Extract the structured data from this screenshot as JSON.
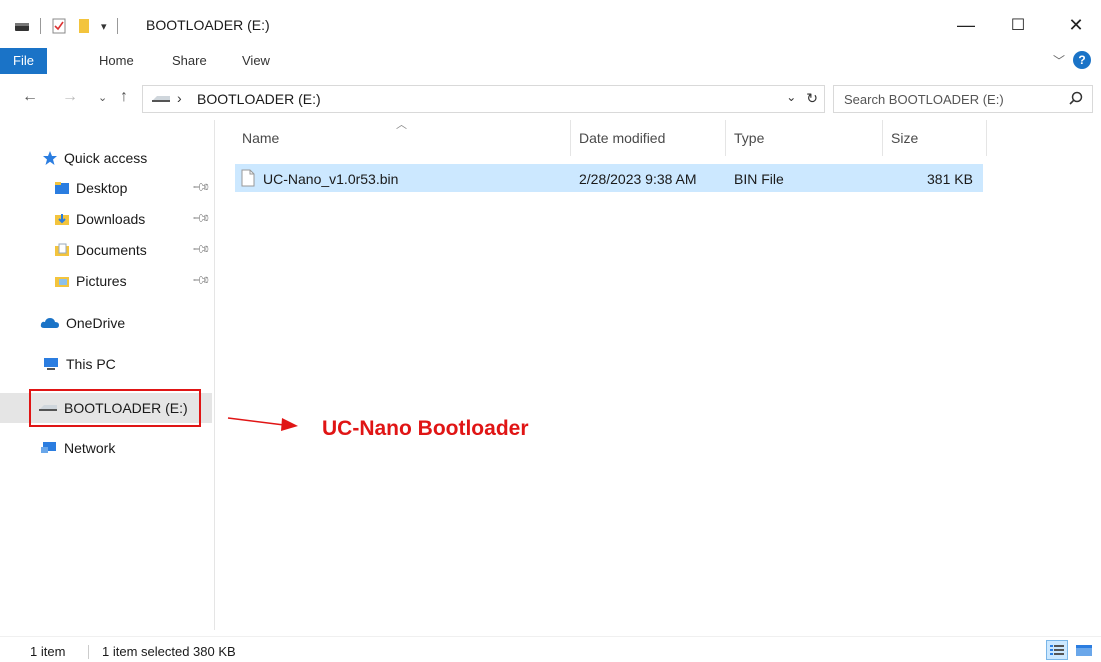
{
  "window": {
    "title": "BOOTLOADER (E:)",
    "controls": {
      "minimize": "—",
      "maximize": "☐",
      "close": "✕"
    }
  },
  "ribbon": {
    "tabs": [
      "File",
      "Home",
      "Share",
      "View"
    ],
    "help": "?"
  },
  "address": {
    "path": "BOOTLOADER (E:)",
    "search_placeholder": "Search BOOTLOADER (E:)"
  },
  "sidebar": {
    "quick_access": "Quick access",
    "pinned": [
      "Desktop",
      "Downloads",
      "Documents",
      "Pictures"
    ],
    "onedrive": "OneDrive",
    "this_pc": "This PC",
    "drive": "BOOTLOADER (E:)",
    "network": "Network"
  },
  "file_list": {
    "columns": [
      "Name",
      "Date modified",
      "Type",
      "Size"
    ],
    "rows": [
      {
        "name": "UC-Nano_v1.0r53.bin",
        "date": "2/28/2023 9:38 AM",
        "type": "BIN File",
        "size": "381 KB"
      }
    ]
  },
  "annotation": {
    "label": "UC-Nano Bootloader",
    "color": "#e01515"
  },
  "status": {
    "items": "1 item",
    "selected": "1 item selected  380 KB"
  },
  "colors": {
    "accent": "#1a73c7",
    "selection": "#cce8ff",
    "highlight": "#e01515"
  }
}
